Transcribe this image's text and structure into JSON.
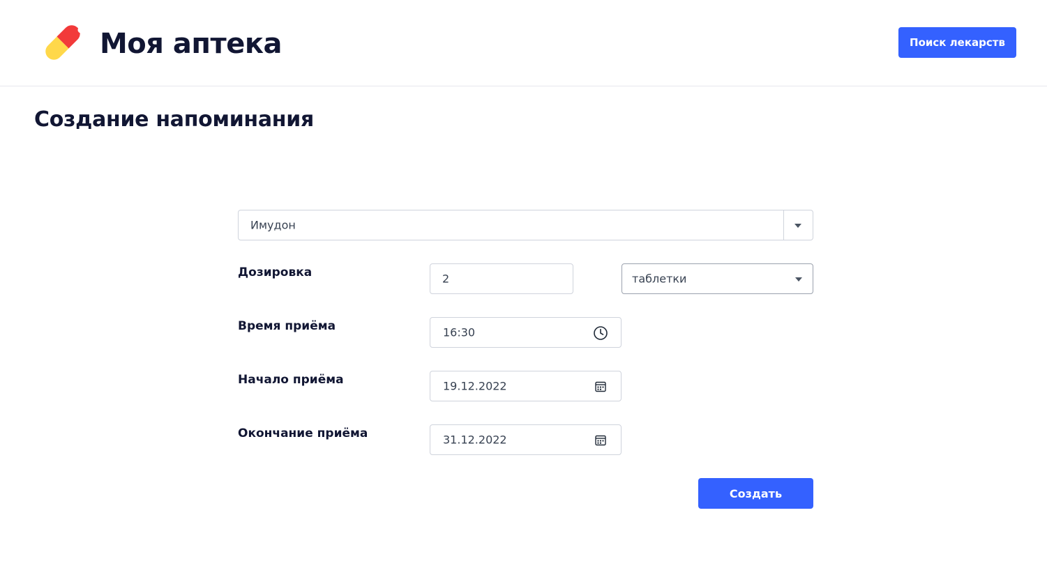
{
  "header": {
    "app_title": "Моя аптека",
    "search_button_label": "Поиск лекарств"
  },
  "page": {
    "title": "Создание напоминания"
  },
  "form": {
    "medicine_select": {
      "value": "Имудон"
    },
    "dosage": {
      "label": "Дозировка",
      "amount": "2",
      "unit": "таблетки"
    },
    "intake_time": {
      "label": "Время приёма",
      "value": "16:30"
    },
    "start_date": {
      "label": "Начало приёма",
      "value": "19.12.2022"
    },
    "end_date": {
      "label": "Окончание приёма",
      "value": "31.12.2022"
    },
    "submit_label": "Создать"
  },
  "icons": {
    "logo": "pill-icon",
    "time": "clock-icon",
    "date": "calendar-icon",
    "dropdown": "caret-down-icon"
  },
  "colors": {
    "accent": "#3461ff",
    "text": "#111633",
    "pill_red": "#f23a3a",
    "pill_yellow": "#ffd84a"
  }
}
